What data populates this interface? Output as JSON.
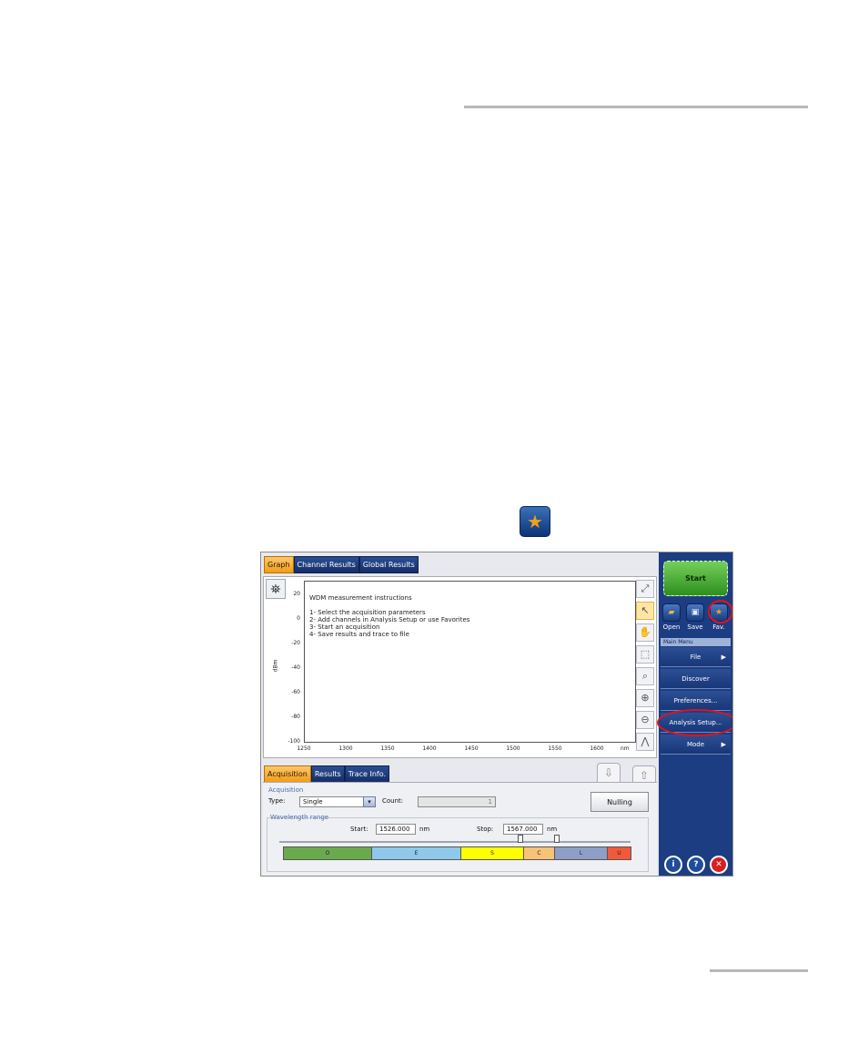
{
  "favorites_icon": "star-icon",
  "app": {
    "top_tabs": [
      "Graph",
      "Channel Results",
      "Global Results"
    ],
    "graph": {
      "y_ticks": [
        "20",
        "0",
        "-20",
        "-40",
        "-60",
        "-80",
        "-100"
      ],
      "x_ticks": [
        "1250",
        "1300",
        "1350",
        "1400",
        "1450",
        "1500",
        "1550",
        "1600"
      ],
      "y_label": "dBm",
      "x_unit": "nm",
      "instructions": [
        "WDM measurement instructions",
        "1- Select the acquisition parameters",
        "2- Add channels in Analysis Setup or use Favorites",
        "3- Start an acquisition",
        "4- Save results and trace to file"
      ]
    },
    "bottom_tabs": [
      "Acquisition",
      "Results",
      "Trace Info."
    ],
    "acquisition": {
      "group_label": "Acquisition",
      "type_label": "Type:",
      "type_value": "Single",
      "count_label": "Count:",
      "count_value": "1",
      "nulling": "Nulling"
    },
    "wavelength": {
      "group_label": "Wavelength range",
      "start_label": "Start:",
      "start_value": "1526.000",
      "stop_label": "Stop:",
      "stop_value": "1567.000",
      "unit": "nm",
      "bands": [
        {
          "label": "O",
          "color": "#6aaa4f"
        },
        {
          "label": "E",
          "color": "#8ec9ec"
        },
        {
          "label": "S",
          "color": "#ffff00"
        },
        {
          "label": "C",
          "color": "#f7c377"
        },
        {
          "label": "L",
          "color": "#8f9ec7"
        },
        {
          "label": "U",
          "color": "#f05a3a"
        }
      ]
    },
    "right_panel": {
      "start": "Start",
      "quick": [
        {
          "label": "Open",
          "icon": "folder-icon"
        },
        {
          "label": "Save",
          "icon": "floppy-disk-icon"
        },
        {
          "label": "Fav.",
          "icon": "star-icon"
        }
      ],
      "main_menu_title": "Main Menu",
      "menu": [
        "File",
        "Discover",
        "Preferences...",
        "Analysis Setup...",
        "Mode"
      ],
      "bottom_icons": [
        "info-icon",
        "help-icon",
        "close-icon"
      ]
    }
  }
}
